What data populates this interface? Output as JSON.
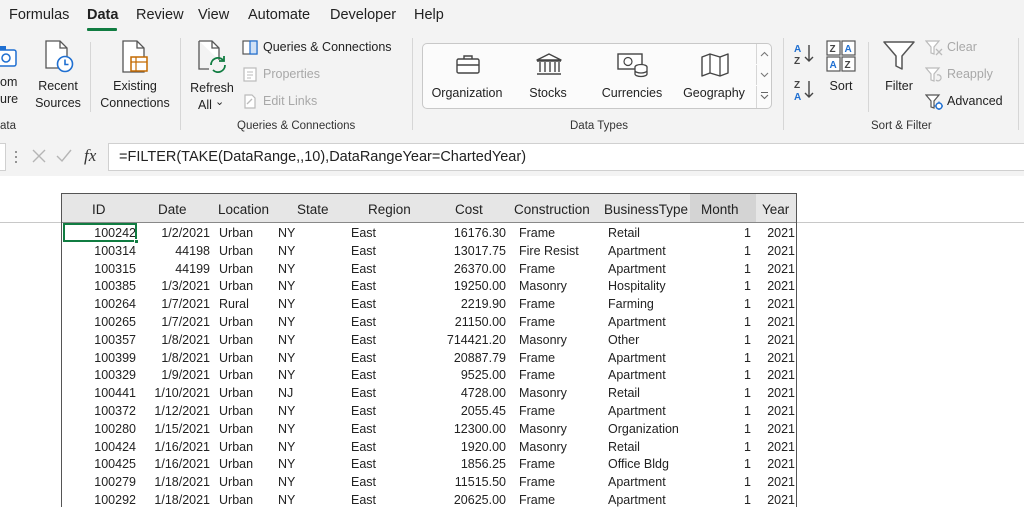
{
  "menu": {
    "items": [
      "Formulas",
      "Data",
      "Review",
      "View",
      "Automate",
      "Developer",
      "Help"
    ],
    "active": "Data"
  },
  "ribbon": {
    "get_data": {
      "from_line1": "om",
      "from_line2": "ure",
      "from_arrow": "⌄",
      "recent_line1": "Recent",
      "recent_line2": "Sources",
      "existing_line1": "Existing",
      "existing_line2": "Connections",
      "group_label": "ata"
    },
    "queries": {
      "refresh_line1": "Refresh",
      "refresh_line2": "All",
      "refresh_arrow": "⌄",
      "queries_connections": "Queries & Connections",
      "properties": "Properties",
      "edit_links": "Edit Links",
      "group_label": "Queries & Connections"
    },
    "data_types": {
      "items": [
        "Organization",
        "Stocks",
        "Currencies",
        "Geography"
      ],
      "group_label": "Data Types"
    },
    "sort_filter": {
      "sort": "Sort",
      "filter": "Filter",
      "clear": "Clear",
      "reapply": "Reapply",
      "advanced": "Advanced",
      "group_label": "Sort & Filter"
    }
  },
  "formula_bar": {
    "fx": "fx",
    "formula": "=FILTER(TAKE(DataRange,,10),DataRangeYear=ChartedYear)"
  },
  "table": {
    "headers": [
      "ID",
      "Date",
      "Location",
      "State",
      "Region",
      "Cost",
      "Construction",
      "BusinessType",
      "Month",
      "Year"
    ],
    "rows": [
      [
        "100242",
        "1/2/2021",
        "Urban",
        "NY",
        "East",
        "16176.30",
        "Frame",
        "Retail",
        "1",
        "2021"
      ],
      [
        "100314",
        "44198",
        "Urban",
        "NY",
        "East",
        "13017.75",
        "Fire Resist",
        "Apartment",
        "1",
        "2021"
      ],
      [
        "100315",
        "44199",
        "Urban",
        "NY",
        "East",
        "26370.00",
        "Frame",
        "Apartment",
        "1",
        "2021"
      ],
      [
        "100385",
        "1/3/2021",
        "Urban",
        "NY",
        "East",
        "19250.00",
        "Masonry",
        "Hospitality",
        "1",
        "2021"
      ],
      [
        "100264",
        "1/7/2021",
        "Rural",
        "NY",
        "East",
        "2219.90",
        "Frame",
        "Farming",
        "1",
        "2021"
      ],
      [
        "100265",
        "1/7/2021",
        "Urban",
        "NY",
        "East",
        "21150.00",
        "Frame",
        "Apartment",
        "1",
        "2021"
      ],
      [
        "100357",
        "1/8/2021",
        "Urban",
        "NY",
        "East",
        "714421.20",
        "Masonry",
        "Other",
        "1",
        "2021"
      ],
      [
        "100399",
        "1/8/2021",
        "Urban",
        "NY",
        "East",
        "20887.79",
        "Frame",
        "Apartment",
        "1",
        "2021"
      ],
      [
        "100329",
        "1/9/2021",
        "Urban",
        "NY",
        "East",
        "9525.00",
        "Frame",
        "Apartment",
        "1",
        "2021"
      ],
      [
        "100441",
        "1/10/2021",
        "Urban",
        "NJ",
        "East",
        "4728.00",
        "Masonry",
        "Retail",
        "1",
        "2021"
      ],
      [
        "100372",
        "1/12/2021",
        "Urban",
        "NY",
        "East",
        "2055.45",
        "Frame",
        "Apartment",
        "1",
        "2021"
      ],
      [
        "100280",
        "1/15/2021",
        "Urban",
        "NY",
        "East",
        "12300.00",
        "Masonry",
        "Organization",
        "1",
        "2021"
      ],
      [
        "100424",
        "1/16/2021",
        "Urban",
        "NY",
        "East",
        "1920.00",
        "Masonry",
        "Retail",
        "1",
        "2021"
      ],
      [
        "100425",
        "1/16/2021",
        "Urban",
        "NY",
        "East",
        "1856.25",
        "Frame",
        "Office Bldg",
        "1",
        "2021"
      ],
      [
        "100279",
        "1/18/2021",
        "Urban",
        "NY",
        "East",
        "11515.50",
        "Frame",
        "Apartment",
        "1",
        "2021"
      ],
      [
        "100292",
        "1/18/2021",
        "Urban",
        "NY",
        "East",
        "20625.00",
        "Frame",
        "Apartment",
        "1",
        "2021"
      ]
    ]
  },
  "colors": {
    "accent": "#107c41",
    "icon_blue": "#1f6fd1",
    "disabled": "#a8a8a8"
  }
}
